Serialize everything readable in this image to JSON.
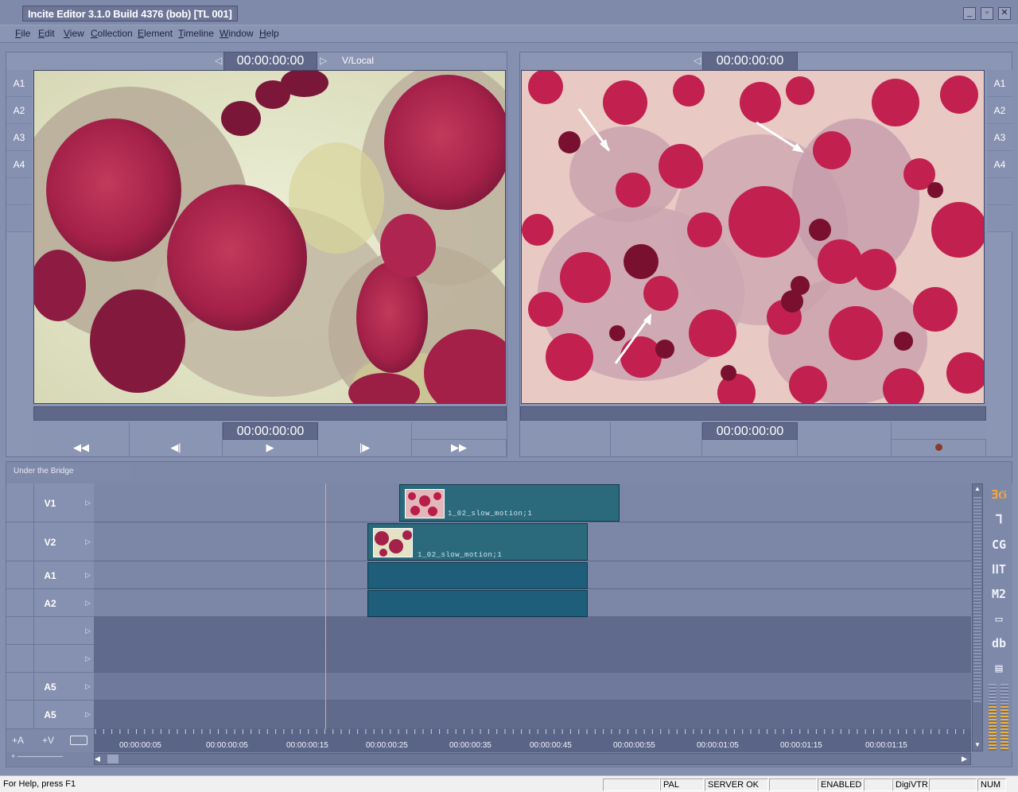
{
  "app": {
    "title": "Incite Editor 3.1.0 Build 4376 (bob) [TL 001]"
  },
  "window_buttons": {
    "minimize": "_",
    "restore": "▫",
    "close": "✕"
  },
  "menu": [
    "File",
    "Edit",
    "View",
    "Collection",
    "Element",
    "Timeline",
    "Window",
    "Help"
  ],
  "source_viewer": {
    "timecode": "00:00:00:00",
    "source_label": "V/Local",
    "bottom_timecode": "00:00:00:00",
    "tracks": [
      "A1",
      "A2",
      "A3",
      "A4"
    ]
  },
  "record_viewer": {
    "timecode": "00:00:00:00",
    "bottom_timecode": "00:00:00:00",
    "tracks": [
      "A1",
      "A2",
      "A3",
      "A4"
    ]
  },
  "transport": {
    "rewind": "◀◀",
    "step_back": "◀|",
    "play": "▶",
    "step_fwd": "|▶",
    "fast_fwd": "▶▶"
  },
  "timeline": {
    "sequence_name": "Under the Bridge",
    "tracks": [
      "V1",
      "V2",
      "A1",
      "A2",
      "",
      "",
      "A5",
      "A5"
    ],
    "clips": [
      {
        "track": "V1",
        "label": "1_02_slow_motion;1"
      },
      {
        "track": "V2",
        "label": "1_02_slow_motion;1"
      }
    ],
    "ruler": [
      "00:00:00:05",
      "00:00:00:05",
      "00:00:00:15",
      "00:00:00:25",
      "00:00:00:35",
      "00:00:00:45",
      "00:00:00:55",
      "00:00:01:05",
      "00:00:01:15",
      "00:00:01:15"
    ],
    "add_audio": "+A",
    "add_video": "+V",
    "tools": [
      "ƎϬ",
      "ᒣ",
      "CG",
      "ⅠⅠT",
      "M2",
      "▭",
      "db",
      "▤"
    ]
  },
  "status": {
    "help": "For Help, press F1",
    "format": "PAL",
    "server": "SERVER OK",
    "enabled": "ENABLED",
    "vtr": "DigiVTR",
    "num": "NUM"
  }
}
